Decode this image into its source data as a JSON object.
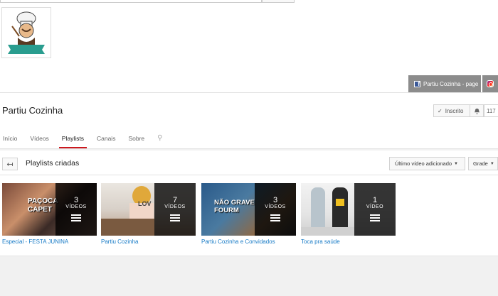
{
  "social_links": {
    "facebook_label": "Partiu Cozinha - page"
  },
  "channel": {
    "title": "Partiu Cozinha",
    "subscribe_label": "Inscrito",
    "subscriber_count": "117"
  },
  "tabs": [
    {
      "label": "Início"
    },
    {
      "label": "Vídeos"
    },
    {
      "label": "Playlists"
    },
    {
      "label": "Canais"
    },
    {
      "label": "Sobre"
    }
  ],
  "subnav": {
    "title": "Playlists criadas",
    "sort_label": "Último vídeo adicionado",
    "view_label": "Grade"
  },
  "playlists": [
    {
      "title": "Especial - FESTA JUNINA",
      "count": "3",
      "count_label": "VÍDEOS",
      "thumb_text": "PAÇOCA CAPET"
    },
    {
      "title": "Partiu Cozinha",
      "count": "7",
      "count_label": "VÍDEOS",
      "thumb_text": "LOV"
    },
    {
      "title": "Partiu Cozinha e Convidados",
      "count": "3",
      "count_label": "VÍDEOS",
      "thumb_text": "NÃO GRAVE FOURM"
    },
    {
      "title": "Toca pra saúde",
      "count": "1",
      "count_label": "VÍDEO",
      "thumb_text": ""
    }
  ]
}
